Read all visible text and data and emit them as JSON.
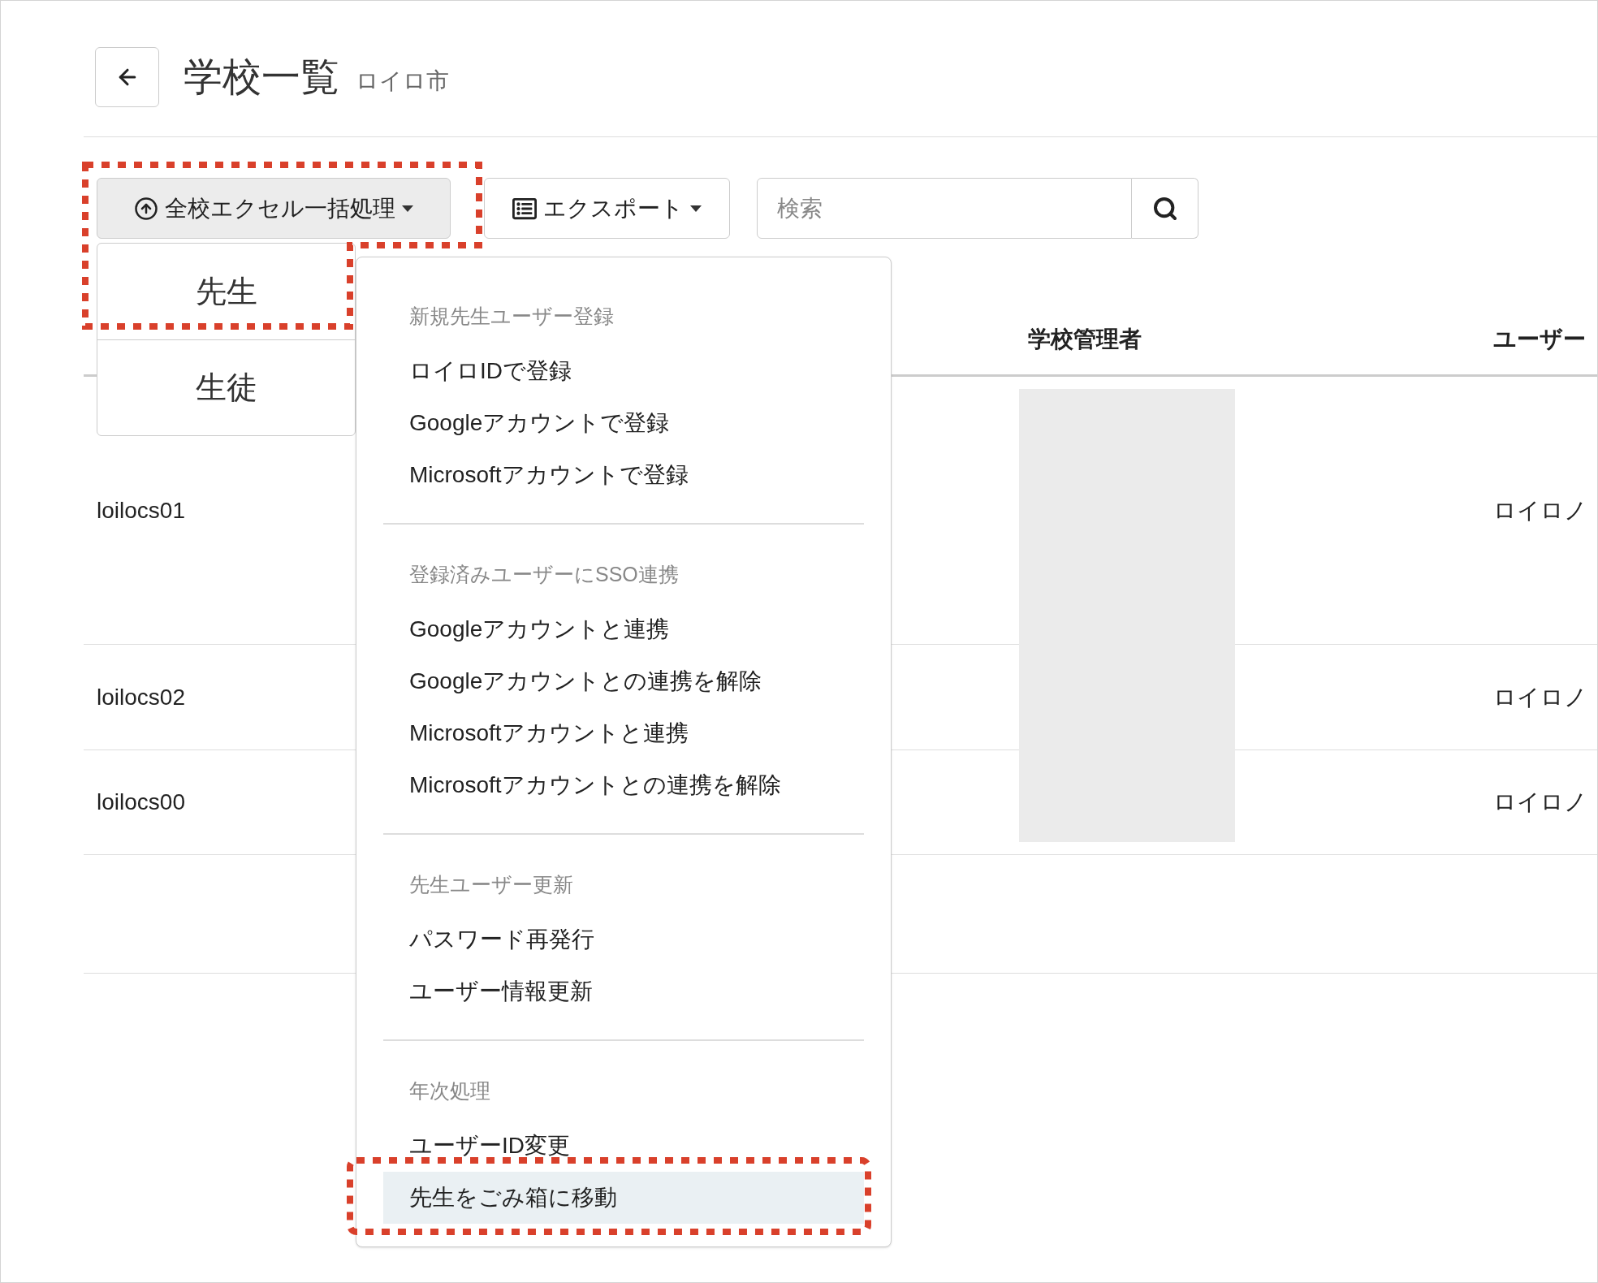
{
  "header": {
    "title": "学校一覧",
    "subtitle": "ロイロ市"
  },
  "toolbar": {
    "bulk_button": "全校エクセル一括処理",
    "export_button": "エクスポート",
    "search": {
      "placeholder": "検索"
    }
  },
  "submenu": {
    "items": [
      {
        "label": "先生"
      },
      {
        "label": "生徒"
      }
    ]
  },
  "dropdown": {
    "sections": [
      {
        "heading": "新規先生ユーザー登録",
        "items": [
          {
            "label": "ロイロIDで登録",
            "highlighted": false
          },
          {
            "label": "Googleアカウントで登録",
            "highlighted": false
          },
          {
            "label": "Microsoftアカウントで登録",
            "highlighted": false
          }
        ]
      },
      {
        "heading": "登録済みユーザーにSSO連携",
        "items": [
          {
            "label": "Googleアカウントと連携",
            "highlighted": false
          },
          {
            "label": "Googleアカウントとの連携を解除",
            "highlighted": false
          },
          {
            "label": "Microsoftアカウントと連携",
            "highlighted": false
          },
          {
            "label": "Microsoftアカウントとの連携を解除",
            "highlighted": false
          }
        ]
      },
      {
        "heading": "先生ユーザー更新",
        "items": [
          {
            "label": "パスワード再発行",
            "highlighted": false
          },
          {
            "label": "ユーザー情報更新",
            "highlighted": false
          }
        ]
      },
      {
        "heading": "年次処理",
        "items": [
          {
            "label": "ユーザーID変更",
            "highlighted": false
          },
          {
            "label": "先生をごみ箱に移動",
            "highlighted": true
          }
        ]
      }
    ]
  },
  "table": {
    "columns": [
      "学校管理者",
      "ユーザー"
    ],
    "rows": [
      {
        "column_1": "loilocs01",
        "user": "ロイロノ"
      },
      {
        "column_1": "loilocs02",
        "user": "ロイロノ"
      },
      {
        "column_1": "loilocs00",
        "user": "ロイロノ"
      }
    ]
  }
}
